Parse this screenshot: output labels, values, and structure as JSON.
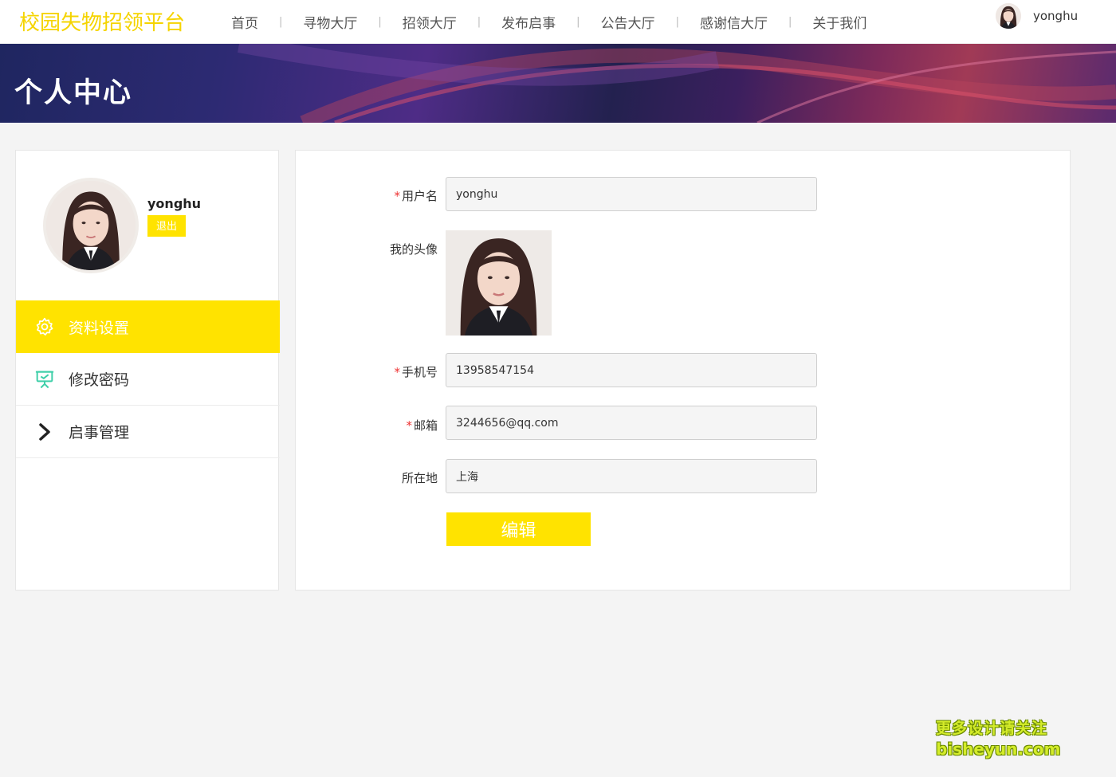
{
  "header": {
    "logo": "校园失物招领平台",
    "nav": [
      {
        "label": "首页"
      },
      {
        "label": "寻物大厅"
      },
      {
        "label": "招领大厅"
      },
      {
        "label": "发布启事"
      },
      {
        "label": "公告大厅"
      },
      {
        "label": "感谢信大厅"
      },
      {
        "label": "关于我们"
      }
    ],
    "separator": "|",
    "username": "yonghu"
  },
  "banner": {
    "title": "个人中心"
  },
  "sidebar": {
    "username": "yonghu",
    "logout_label": "退出",
    "menu": [
      {
        "label": "资料设置",
        "icon": "gear-icon",
        "active": true
      },
      {
        "label": "修改密码",
        "icon": "presentation-board-icon",
        "active": false
      },
      {
        "label": "启事管理",
        "icon": "chevron-right-icon",
        "active": false
      }
    ]
  },
  "form": {
    "username_label": "用户名",
    "username_value": "yonghu",
    "avatar_label": "我的头像",
    "phone_label": "手机号",
    "phone_value": "13958547154",
    "email_label": "邮箱",
    "email_value": "3244656@qq.com",
    "location_label": "所在地",
    "location_value": "上海",
    "required_mark": "*",
    "edit_label": "编辑"
  },
  "watermark": {
    "line1": "更多设计请关注",
    "line2": "bisheyun.com"
  },
  "colors": {
    "accent": "#ffe300",
    "logo": "#f5d400",
    "required": "#ee3333"
  }
}
